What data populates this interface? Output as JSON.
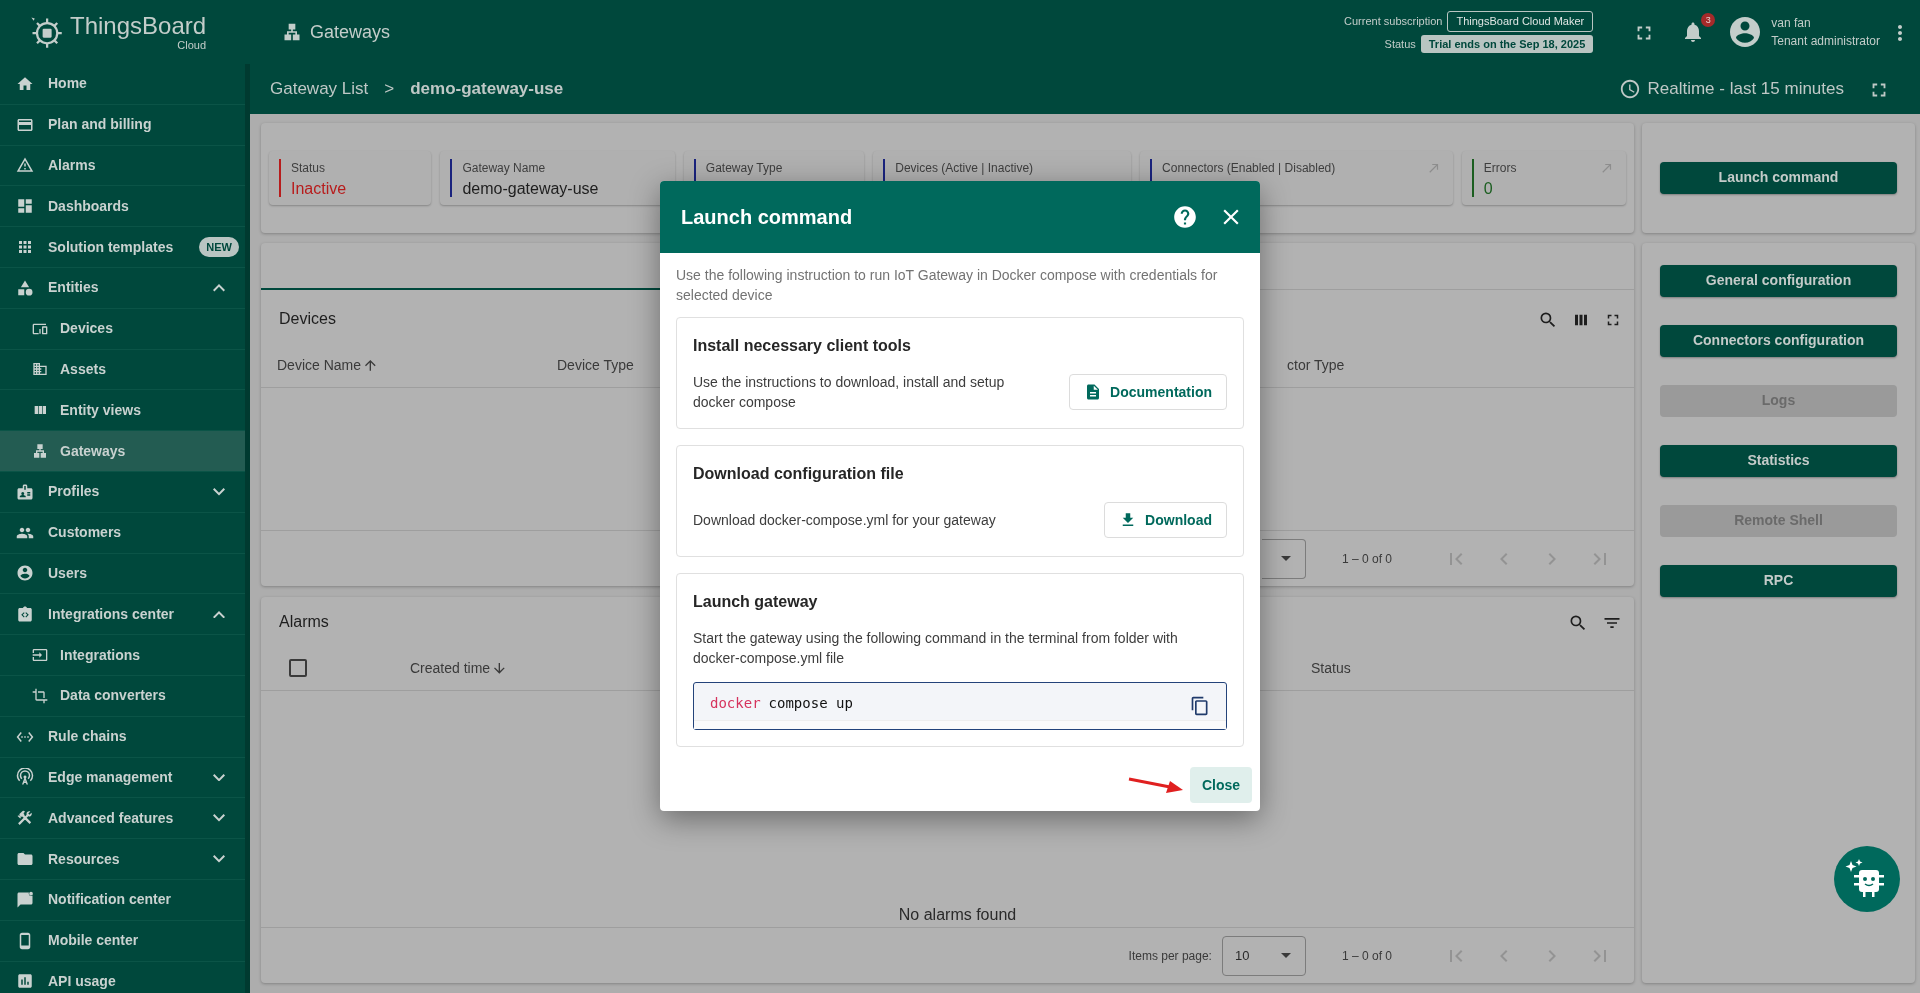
{
  "header": {
    "logo": {
      "name": "ThingsBoard",
      "edition": "Cloud"
    },
    "page_title": "Gateways",
    "subscription_label": "Current subscription",
    "subscription": "ThingsBoard Cloud Maker",
    "status_label": "Status",
    "status": "Trial ends on the Sep 18, 2025",
    "notifications": "3",
    "user": {
      "name": "van fan",
      "role": "Tenant administrator"
    }
  },
  "sidebar": {
    "items": [
      {
        "label": "Home",
        "selected": false
      },
      {
        "label": "Plan and billing",
        "selected": false
      },
      {
        "label": "Alarms",
        "selected": false
      },
      {
        "label": "Dashboards",
        "selected": false
      },
      {
        "label": "Solution templates",
        "selected": false,
        "badge": "NEW"
      },
      {
        "label": "Entities",
        "selected": false,
        "expanded": true,
        "children": [
          {
            "label": "Devices",
            "selected": false
          },
          {
            "label": "Assets",
            "selected": false
          },
          {
            "label": "Entity views",
            "selected": false
          },
          {
            "label": "Gateways",
            "selected": true
          }
        ]
      },
      {
        "label": "Profiles",
        "selected": false,
        "expanded": false
      },
      {
        "label": "Customers",
        "selected": false
      },
      {
        "label": "Users",
        "selected": false
      },
      {
        "label": "Integrations center",
        "selected": false,
        "expanded": true,
        "children": [
          {
            "label": "Integrations",
            "selected": false
          },
          {
            "label": "Data converters",
            "selected": false
          }
        ]
      },
      {
        "label": "Rule chains",
        "selected": false
      },
      {
        "label": "Edge management",
        "selected": false,
        "expanded": false
      },
      {
        "label": "Advanced features",
        "selected": false,
        "expanded": false
      },
      {
        "label": "Resources",
        "selected": false,
        "expanded": false
      },
      {
        "label": "Notification center",
        "selected": false
      },
      {
        "label": "Mobile center",
        "selected": false
      },
      {
        "label": "API usage",
        "selected": false
      }
    ]
  },
  "breadcrumb": {
    "items": [
      "Gateway List",
      "demo-gateway-use"
    ],
    "separator": ">"
  },
  "timewindow": "Realtime - last 15 minutes",
  "stats": [
    {
      "label": "Status",
      "value": "Inactive",
      "color": "#b71c1c",
      "kind": "colored"
    },
    {
      "label": "Gateway Name",
      "value": "demo-gateway-use",
      "color": "#1a237e",
      "kind": "plain"
    },
    {
      "label": "Gateway Type",
      "color": "#1a237e",
      "kind": "plain"
    },
    {
      "label": "Devices (Active | Inactive)",
      "color": "#1a237e",
      "kind": "plain"
    },
    {
      "label": "Connectors (Enabled | Disabled)",
      "color": "#1a237e",
      "kind": "plain",
      "link": true
    },
    {
      "label": "Errors",
      "value": "0",
      "color": "#1b5e20",
      "kind": "colored",
      "link": true
    }
  ],
  "devices": {
    "title": "Devices",
    "columns": [
      {
        "label": "Device Name",
        "sorted": true,
        "ascending": true
      },
      {
        "label": "Device Type"
      },
      {
        "label": "ctor Type"
      }
    ],
    "pagination": {
      "range": "1 – 0 of 0"
    }
  },
  "alarms": {
    "title": "Alarms",
    "select_all_checked": false,
    "columns": [
      {
        "label": "Created time",
        "sorted": true,
        "ascending": false
      },
      {
        "label": "Status"
      }
    ],
    "empty_text": "No alarms found",
    "pagination": {
      "items_per_page_label": "Items per page:",
      "items_per_page": "10",
      "range": "1 – 0 of 0"
    }
  },
  "launch_button": {
    "label": "Launch command",
    "disabled": false
  },
  "actions": [
    {
      "label": "General configuration",
      "disabled": false
    },
    {
      "label": "Connectors configuration",
      "disabled": false
    },
    {
      "label": "Logs",
      "disabled": true
    },
    {
      "label": "Statistics",
      "disabled": false
    },
    {
      "label": "Remote Shell",
      "disabled": true
    },
    {
      "label": "RPC",
      "disabled": false
    }
  ],
  "dialog": {
    "title": "Launch command",
    "intro": "Use the following instruction to run IoT Gateway in Docker compose with credentials for selected device",
    "sections": [
      {
        "title": "Install necessary client tools",
        "description": "Use the instructions to download, install and setup docker compose",
        "button": {
          "label": "Documentation",
          "kind": "document"
        }
      },
      {
        "title": "Download configuration file",
        "description": "Download docker-compose.yml for your gateway",
        "button": {
          "label": "Download",
          "kind": "download"
        }
      },
      {
        "title": "Launch gateway",
        "description": "Start the gateway using the following command in the terminal from folder with docker-compose.yml file",
        "code": [
          {
            "text": "docker",
            "kind": "keyword"
          },
          {
            "text": "compose up",
            "kind": "plain"
          }
        ]
      }
    ],
    "close": "Close"
  }
}
